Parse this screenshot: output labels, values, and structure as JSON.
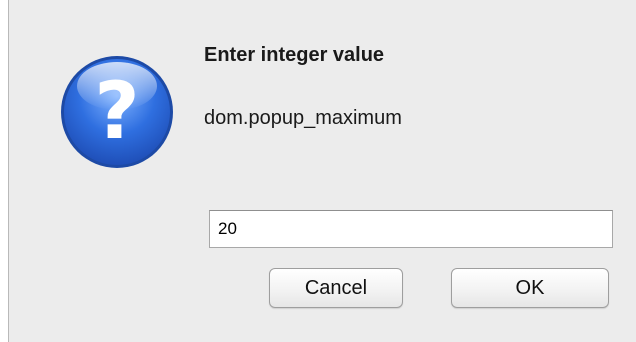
{
  "dialog": {
    "title": "Enter integer value",
    "message": "dom.popup_maximum",
    "icon": "question-mark-icon",
    "input": {
      "value": "20",
      "placeholder": ""
    },
    "buttons": {
      "cancel_label": "Cancel",
      "ok_label": "OK"
    }
  },
  "colors": {
    "dialog_background": "#ececec",
    "icon_blue": "#2f6fe0",
    "input_background": "#ffffff"
  }
}
